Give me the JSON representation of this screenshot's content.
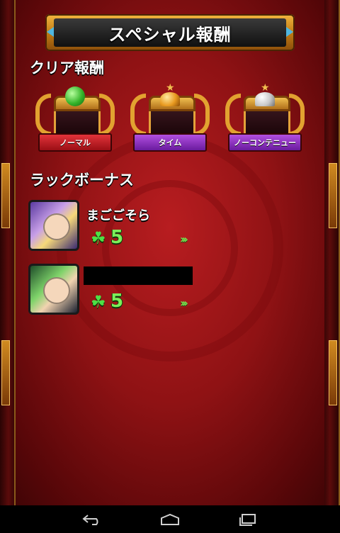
{
  "header": {
    "title": "スペシャル報酬"
  },
  "clear_rewards": {
    "heading": "クリア報酬",
    "items": [
      {
        "label": "ノーマル",
        "icon": "green-orb-chest-icon",
        "color": "#c21c24"
      },
      {
        "label": "タイム",
        "icon": "gold-helmet-chest-icon",
        "color": "#8a2bc0"
      },
      {
        "label": "ノーコンテニュー",
        "icon": "silver-helmet-chest-icon",
        "color": "#8a2bc0"
      }
    ]
  },
  "luck_bonus": {
    "heading": "ラックボーナス",
    "players": [
      {
        "name": "まごごそら",
        "luck": "5",
        "clover": "☘"
      },
      {
        "name": "",
        "luck": "5",
        "clover": "☘"
      }
    ]
  },
  "android_nav": {
    "icons": [
      "back-icon",
      "home-icon",
      "recent-apps-icon"
    ]
  }
}
